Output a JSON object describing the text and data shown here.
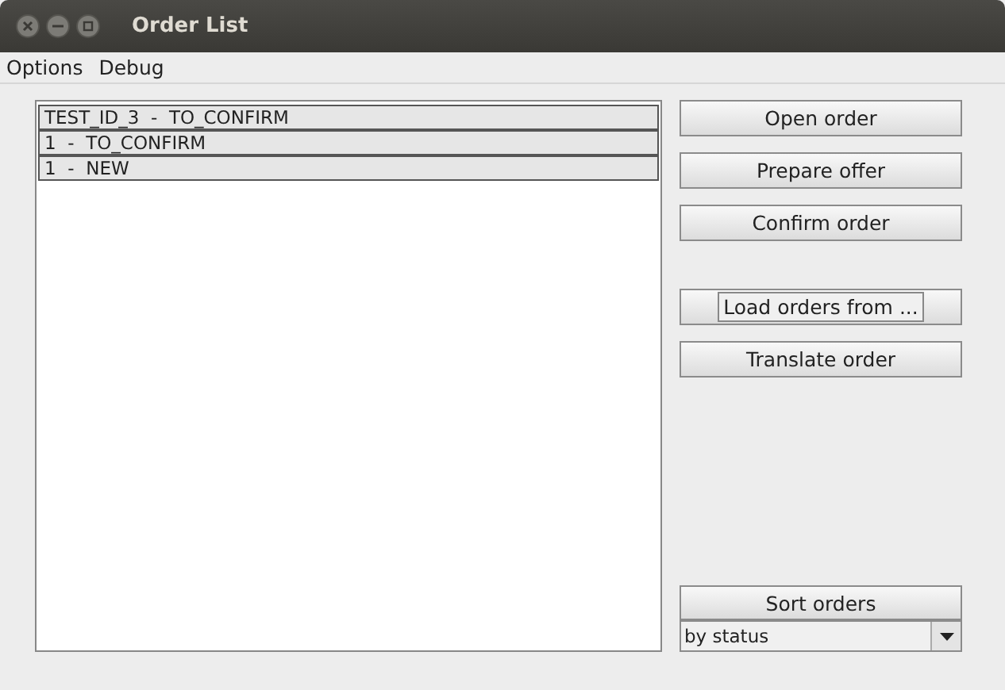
{
  "window": {
    "title": "Order List"
  },
  "menu": [
    "Options",
    "Debug"
  ],
  "orders": [
    {
      "label": "TEST_ID_3  -  TO_CONFIRM",
      "selected": false
    },
    {
      "label": "1  -  TO_CONFIRM",
      "selected": false
    },
    {
      "label": "1  -  NEW",
      "selected": false
    }
  ],
  "button_groups": [
    [
      {
        "label": "Open order",
        "focused": false
      },
      {
        "label": "Prepare offer",
        "focused": false
      },
      {
        "label": "Confirm order",
        "focused": false
      }
    ],
    [
      {
        "label": "Load orders from ...",
        "focused": true
      },
      {
        "label": "Translate order",
        "focused": false
      }
    ]
  ],
  "sort": {
    "button": "Sort orders",
    "value": "by status"
  }
}
